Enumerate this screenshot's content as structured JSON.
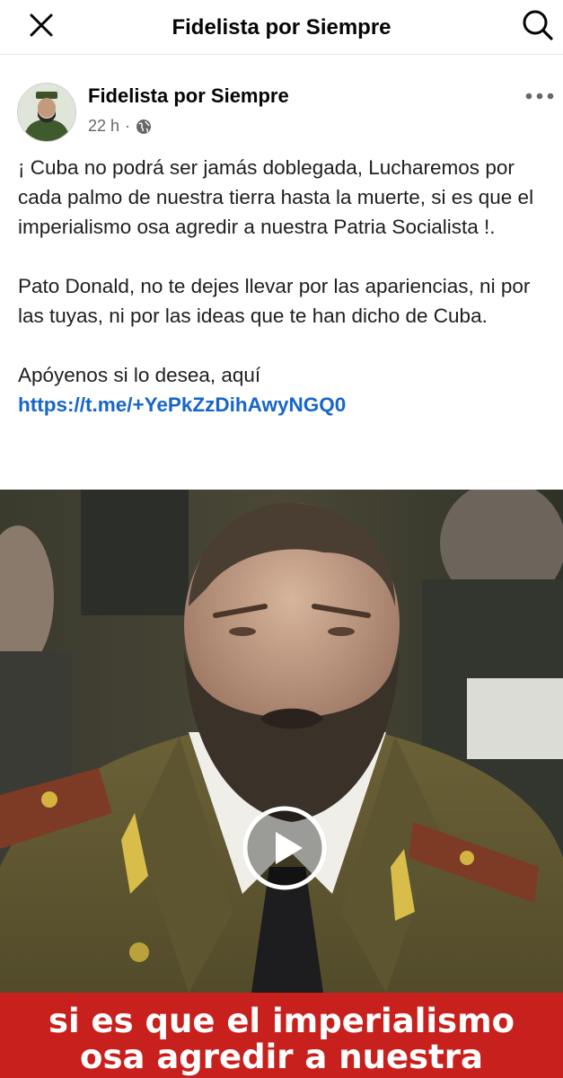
{
  "header": {
    "title": "Fidelista por Siempre",
    "close_icon": "close-icon",
    "search_icon": "search-icon"
  },
  "post": {
    "author": "Fidelista por Siempre",
    "time": "22 h",
    "separator": "·",
    "audience_icon": "globe-icon",
    "more_icon": "more-horizontal-icon",
    "paragraphs": [
      "¡ Cuba no podrá ser jamás doblegada, Lucharemos por cada palmo de nuestra tierra hasta la muerte, si es que el imperialismo osa agredir a nuestra Patria Socialista !.",
      "Pato Donald, no te dejes llevar por las apariencias, ni por las tuyas, ni por las ideas que te han dicho de Cuba.",
      "Apóyenos si lo desea, aquí"
    ],
    "link": "https://t.me/+YePkZzDihAwyNGQ0"
  },
  "video": {
    "play_icon": "play-icon",
    "caption_line1": "si es que el imperialismo",
    "caption_line2": "osa agredir a nuestra"
  },
  "colors": {
    "link": "#1766c9",
    "caption_bg": "#c8201c",
    "meta": "#65676b"
  }
}
